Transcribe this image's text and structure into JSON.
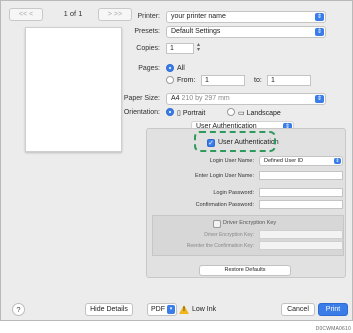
{
  "preview": {
    "prev_label": "<<  <",
    "page_count": "1 of 1",
    "next_label": ">  >>"
  },
  "settings": {
    "printer_label": "Printer:",
    "printer_value": "your printer name",
    "presets_label": "Presets:",
    "presets_value": "Default Settings",
    "copies_label": "Copies:",
    "copies_value": "1",
    "pages_label": "Pages:",
    "pages_all": "All",
    "pages_from": "From:",
    "pages_from_value": "1",
    "pages_to": "to:",
    "pages_to_value": "1",
    "paper_size_label": "Paper Size:",
    "paper_size_value": "A4",
    "paper_size_dims": "210 by 297 mm",
    "orientation_label": "Orientation:",
    "portrait": "Portrait",
    "landscape": "Landscape",
    "section_value": "User Authentication"
  },
  "auth": {
    "checkbox_label": "User Authentication",
    "login_name_label": "Login User Name:",
    "login_name_value": "Defined User ID",
    "enter_login_label": "Enter Login User Name:",
    "password_label": "Login Password:",
    "confirm_label": "Confirmation Password:",
    "encrypt_label": "Driver Encryption Key",
    "encrypt_key_label": "Driver Encryption Key:",
    "reenter_label": "Reenter the Confirmation Key:",
    "restore_button": "Restore Defaults"
  },
  "footer": {
    "help": "?",
    "hide_details": "Hide Details",
    "pdf": "PDF",
    "low_ink": "Low Ink",
    "cancel": "Cancel",
    "print": "Print"
  },
  "figure_code": "D0CWMA0610",
  "colors": {
    "accent": "#3a7de8",
    "highlight": "#2e9a5e",
    "warning": "#f2b41b"
  }
}
